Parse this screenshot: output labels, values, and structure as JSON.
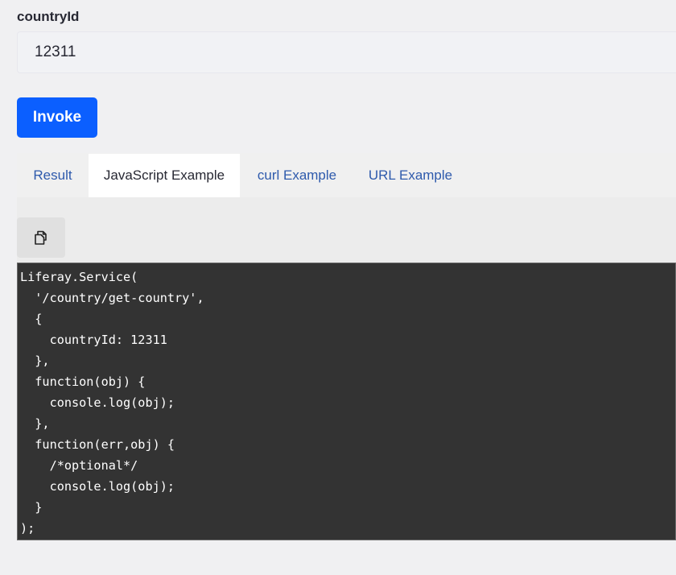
{
  "form": {
    "field_label": "countryId",
    "field_value": "12311",
    "invoke_label": "Invoke"
  },
  "tabs": [
    {
      "label": "Result",
      "active": false
    },
    {
      "label": "JavaScript Example",
      "active": true
    },
    {
      "label": "curl Example",
      "active": false
    },
    {
      "label": "URL Example",
      "active": false
    }
  ],
  "copy_button": {
    "icon": "copy-icon"
  },
  "code": {
    "lines": [
      "Liferay.Service(",
      "  '/country/get-country',",
      "  {",
      "    countryId: 12311",
      "  },",
      "  function(obj) {",
      "    console.log(obj);",
      "  },",
      "  function(err,obj) {",
      "    /*optional*/",
      "    console.log(obj);",
      "  }",
      ");"
    ]
  },
  "colors": {
    "accent": "#0b5fff",
    "link": "#2e5aac",
    "code_background": "#333333"
  }
}
